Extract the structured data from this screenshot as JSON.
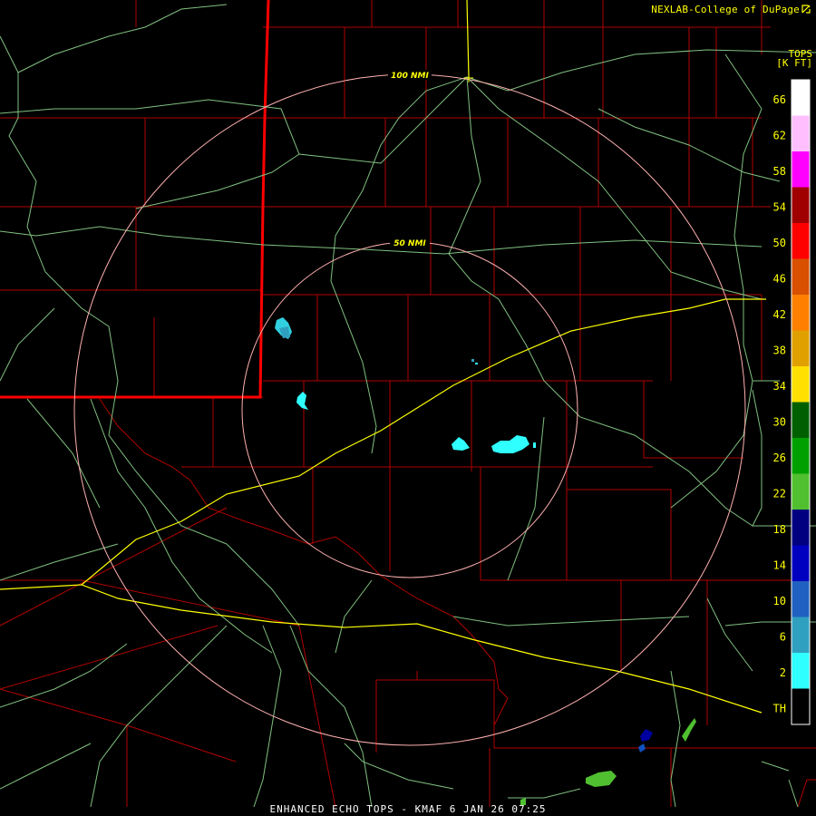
{
  "credit": {
    "text": "NEXLAB-College of DuPage",
    "logo_icon": "cod-logo-icon"
  },
  "footer": {
    "text": "ENHANCED ECHO TOPS - KMAF 6 JAN 26 07:25"
  },
  "legend": {
    "title_line1": "TOPS",
    "title_line2": "[K FT]",
    "ticks": [
      "66",
      "62",
      "58",
      "54",
      "50",
      "46",
      "42",
      "38",
      "34",
      "30",
      "26",
      "22",
      "18",
      "14",
      "10",
      "6",
      "2",
      "TH"
    ],
    "colors": [
      "#ffffff",
      "#ffbfff",
      "#ff00ff",
      "#a00000",
      "#ff0000",
      "#d85000",
      "#ff8000",
      "#e0a000",
      "#ffe000",
      "#006000",
      "#00a000",
      "#50c030",
      "#000080",
      "#0000c0",
      "#2060c0",
      "#30a0c0",
      "#30ffff",
      "#000000"
    ]
  },
  "rings": [
    {
      "label": "100 NMI",
      "color": "#ffb0b0"
    },
    {
      "label": "50 NMI",
      "color": "#ffb0b0"
    }
  ],
  "map_colors": {
    "county": "#b00000",
    "state": "#ff0000",
    "highway": "#ffff00",
    "road": "#80c080"
  }
}
